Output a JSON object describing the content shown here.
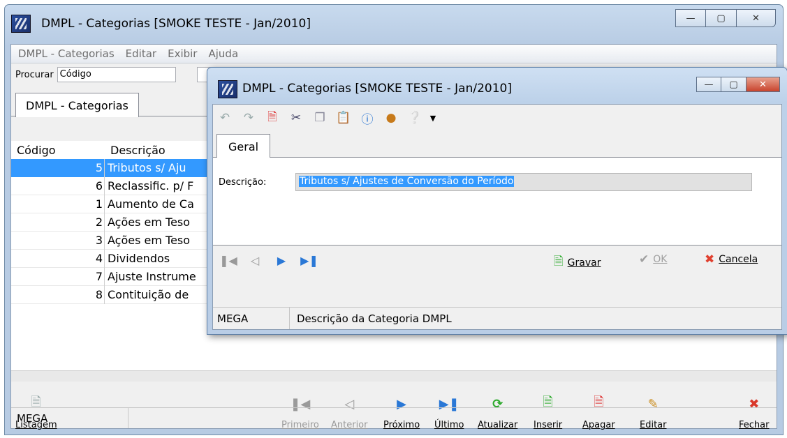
{
  "main_window": {
    "title": "DMPL - Categorias [SMOKE TESTE - Jan/2010]",
    "caption_buttons": {
      "minimize": "—",
      "maximize": "▢",
      "close": "✕"
    },
    "menu": [
      "DMPL - Categorias",
      "Editar",
      "Exibir",
      "Ajuda"
    ],
    "search": {
      "label": "Procurar",
      "value": "Código"
    },
    "tab": "DMPL - Categorias",
    "grid": {
      "headers": [
        "Código",
        "Descrição"
      ],
      "rows": [
        {
          "code": "5",
          "desc": "Tributos s/ Aju"
        },
        {
          "code": "6",
          "desc": "Reclassific. p/ F"
        },
        {
          "code": "1",
          "desc": "Aumento de Ca"
        },
        {
          "code": "2",
          "desc": "Ações em Teso"
        },
        {
          "code": "3",
          "desc": "Ações em Teso"
        },
        {
          "code": "4",
          "desc": "Dividendos"
        },
        {
          "code": "7",
          "desc": "Ajuste Instrume"
        },
        {
          "code": "8",
          "desc": "Contituição de"
        }
      ]
    },
    "toolbar": {
      "listagem": "Listagem",
      "primeiro": "Primeiro",
      "anterior": "Anterior",
      "proximo": "Próximo",
      "ultimo": "Último",
      "atualizar": "Atualizar",
      "inserir": "Inserir",
      "apagar": "Apagar",
      "editar": "Editar",
      "fechar": "Fechar"
    },
    "status": "MEGA"
  },
  "dialog": {
    "title": "DMPL - Categorias [SMOKE TESTE - Jan/2010]",
    "tab": "Geral",
    "field_label": "Descrição:",
    "field_value": "Tributos s/ Ajustes de Conversão do Período",
    "actions": {
      "gravar": "Gravar",
      "ok": "OK",
      "cancela": "Cancela"
    },
    "status_left": "MEGA",
    "status_text": "Descrição da Categoria DMPL"
  },
  "colors": {
    "selection": "#3399ff",
    "window_frame": "#b9cde6",
    "close_red": "#c8432d"
  }
}
